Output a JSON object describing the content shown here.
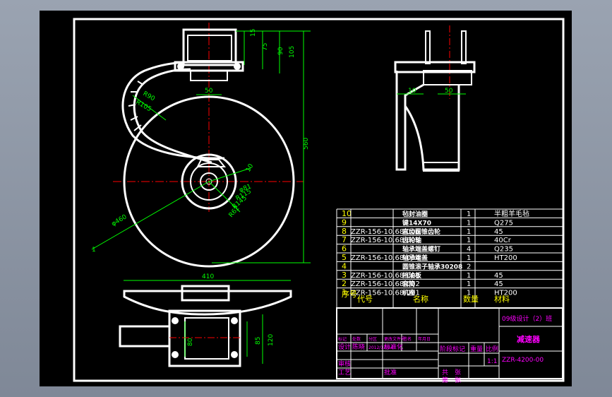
{
  "dimensions": {
    "top_view": [
      "15",
      "75",
      "90",
      "105",
      "50",
      "R90",
      "R105",
      "560",
      "10",
      "φ81",
      "R115",
      "R145",
      "R62",
      "φ460"
    ],
    "side_view": [
      "10",
      "50"
    ],
    "bottom_view": [
      "410",
      "80",
      "85",
      "120"
    ]
  },
  "bom_rows": [
    {
      "no": "10",
      "code": "",
      "name": "毡封油圈",
      "qty": "1",
      "material": "半粗羊毛毡"
    },
    {
      "no": "9",
      "code": "",
      "name": "键14X70",
      "qty": "1",
      "material": "Q275"
    },
    {
      "no": "8",
      "code": "ZZR-156-10.68-006",
      "name": "直齿圆锥齿轮",
      "qty": "1",
      "material": "45"
    },
    {
      "no": "7",
      "code": "ZZR-156-10.68-005",
      "name": "齿轮轴",
      "qty": "1",
      "material": "40Cr"
    },
    {
      "no": "6",
      "code": "",
      "name": "轴承端盖螺钉",
      "qty": "4",
      "material": "Q235"
    },
    {
      "no": "5",
      "code": "ZZR-156-10.68-004",
      "name": "轴承端盖",
      "qty": "1",
      "material": "HT200"
    },
    {
      "no": "4",
      "code": "",
      "name": "圆锥滚子轴承30208",
      "qty": "2",
      "material": ""
    },
    {
      "no": "3",
      "code": "ZZR-156-10.68-003",
      "name": "挡油板",
      "qty": "1",
      "material": "45"
    },
    {
      "no": "2",
      "code": "ZZR-156-10.68-002",
      "name": "套筒",
      "qty": "1",
      "material": "45"
    },
    {
      "no": "1",
      "code": "ZZR-156-10.68-001",
      "name": "机座",
      "qty": "1",
      "material": "HT200"
    }
  ],
  "bom_header": {
    "no": "序号",
    "code": "代号",
    "name": "名称",
    "qty": "数量",
    "material": "材料"
  },
  "title_block": {
    "school": "09级设计（2）班",
    "drawing_name": "减速器",
    "drawing_no": "ZZR-4200-00",
    "scale": "1:1",
    "stage_label": "阶段标记",
    "weight_label": "重量",
    "scale_label": "比例",
    "sheet_total": "共　张",
    "sheet_no": "第　张",
    "rev_headers": [
      "标记",
      "处数",
      "分区",
      "更改文件号",
      "签名",
      "年月日"
    ],
    "design_label": "设计",
    "design_person": "陈晓",
    "design_date": "2012/12/24",
    "standard_label": "标准化",
    "review_label": "审核",
    "craft_label": "工艺",
    "approve_label": "批准"
  },
  "colors": {
    "background": "#000000",
    "frame": "#ffffff",
    "dimension": "#00ff00",
    "centerline": "#ff0000",
    "bom_text": "#ffff00",
    "title_text": "#ff00ff"
  }
}
